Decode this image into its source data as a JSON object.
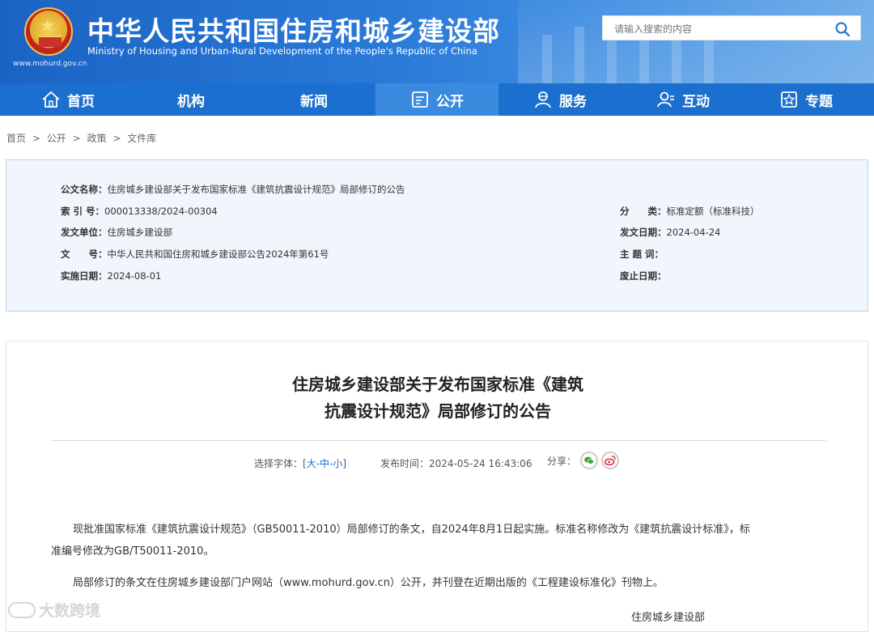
{
  "header": {
    "site_title": "中华人民共和国住房和城乡建设部",
    "site_subtitle": "Ministry of Housing and Urban-Rural Development of the People's Republic of China",
    "site_url": "www.mohurd.gov.cn",
    "search_placeholder": "请输入搜索的内容"
  },
  "nav": {
    "items": [
      {
        "label": "首页",
        "icon": "home-icon"
      },
      {
        "label": "机构"
      },
      {
        "label": "新闻"
      },
      {
        "label": "公开",
        "icon": "document-icon",
        "active": true
      },
      {
        "label": "服务",
        "icon": "service-icon"
      },
      {
        "label": "互动",
        "icon": "user-icon"
      },
      {
        "label": "专题",
        "icon": "star-icon"
      }
    ]
  },
  "breadcrumb": [
    "首页",
    ">",
    "公开",
    ">",
    "政策",
    ">",
    "文件库"
  ],
  "info": {
    "doc_name_label": "公文名称：",
    "doc_name": "住房城乡建设部关于发布国家标准《建筑抗震设计规范》局部修订的公告",
    "index_label": "索 引 号：",
    "index": "000013338/2024-00304",
    "category_label": "分　　类：",
    "category": "标准定额（标准科技）",
    "issuer_label": "发文单位：",
    "issuer": "住房城乡建设部",
    "issue_date_label": "发文日期：",
    "issue_date": "2024-04-24",
    "doc_no_label": "文　　号：",
    "doc_no": "中华人民共和国住房和城乡建设部公告2024年第61号",
    "keywords_label": "主 题 词：",
    "keywords": "",
    "effective_label": "实施日期：",
    "effective": "2024-08-01",
    "repeal_label": "废止日期：",
    "repeal": ""
  },
  "article": {
    "title_line1": "住房城乡建设部关于发布国家标准《建筑",
    "title_line2": "抗震设计规范》局部修订的公告",
    "font_label": "选择字体：[",
    "font_large": "大",
    "font_sep1": "-",
    "font_medium": "中",
    "font_sep2": "-",
    "font_small": "小",
    "font_close": "]",
    "publish_time": "发布时间：2024-05-24 16:43:06",
    "share_label": "分享：",
    "para1_line1": "现批准国家标准《建筑抗震设计规范》（GB50011-2010）局部修订的条文，自2024年8月1日起实施。标准名称修改为《建筑抗震设计标准》，标",
    "para1_line2": "准编号修改为GB/T50011-2010。",
    "para2": "局部修订的条文在住房城乡建设部门户网站（www.mohurd.gov.cn）公开，并刊登在近期出版的《工程建设标准化》刊物上。",
    "signer": "住房城乡建设部"
  },
  "watermark": "大数跨境"
}
